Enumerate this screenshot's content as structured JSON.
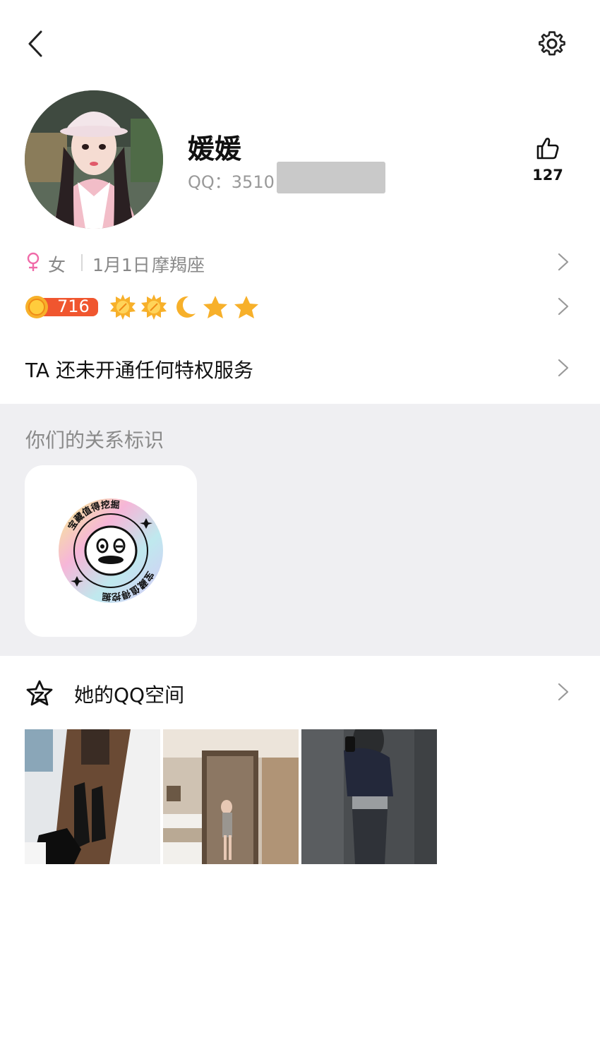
{
  "header": {
    "back_icon": "chevron-left-icon",
    "settings_icon": "gear-icon"
  },
  "profile": {
    "name": "媛媛",
    "qq_label": "QQ：3510",
    "likes_count": "127",
    "like_icon": "thumbs-up-icon"
  },
  "info_row": {
    "gender_icon": "female-icon",
    "gender": "女",
    "birthday": "1月1日",
    "zodiac": "摩羯座"
  },
  "level_row": {
    "score": "716",
    "icons": [
      "sun-icon",
      "sun-icon",
      "moon-icon",
      "star-icon",
      "star-icon"
    ]
  },
  "privilege_row": {
    "label": "TA 还未开通任何特权服务"
  },
  "relationship": {
    "section_title": "你们的关系标识",
    "badge_text": "宝藏值得挖掘",
    "badge_icon": "emoji-face-icon"
  },
  "qzone": {
    "icon": "star-outline-icon",
    "label": "她的QQ空间",
    "photos": [
      "photo-1",
      "photo-2",
      "photo-3"
    ]
  },
  "colors": {
    "gender": "#f06aa8",
    "gray_text": "#888888",
    "band": "#efeff2",
    "badge_orange": "#f0562f"
  }
}
